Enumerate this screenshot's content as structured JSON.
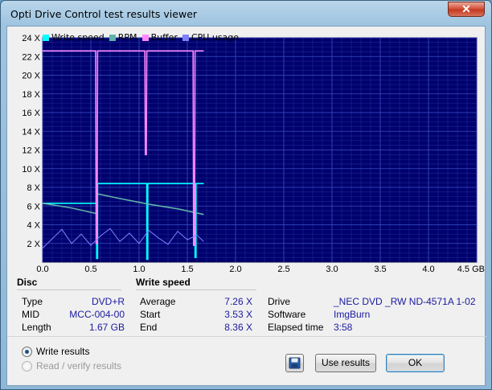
{
  "window": {
    "title": "Opti Drive Control test results viewer",
    "close_glyph": "✕"
  },
  "legend": [
    {
      "label": "Write speed",
      "color": "#00ffff"
    },
    {
      "label": "RPM",
      "color": "#5fb3a9"
    },
    {
      "label": "Buffer",
      "color": "#ff88ff"
    },
    {
      "label": "CPU usage",
      "color": "#8080ff"
    }
  ],
  "chart_data": {
    "type": "line",
    "xlim": [
      0,
      4.5
    ],
    "ylim": [
      0,
      24
    ],
    "x_ticks": [
      "0.0",
      "0.5",
      "1.0",
      "1.5",
      "2.0",
      "2.5",
      "3.0",
      "3.5",
      "4.0",
      "4.5 GB"
    ],
    "y_ticks": [
      "2 X",
      "4 X",
      "6 X",
      "8 X",
      "10 X",
      "12 X",
      "14 X",
      "16 X",
      "18 X",
      "20 X",
      "22 X",
      "24 X"
    ],
    "grid": true,
    "background": "#00006e",
    "series": [
      {
        "name": "Write speed",
        "color": "#00ffff",
        "x": [
          0.0,
          0.56,
          0.56,
          0.57,
          0.57,
          1.08,
          1.08,
          1.09,
          1.09,
          1.58,
          1.58,
          1.59,
          1.59,
          1.67
        ],
        "y": [
          6.3,
          6.3,
          0.4,
          0.4,
          8.4,
          8.4,
          0.3,
          0.3,
          8.4,
          8.4,
          0.5,
          0.5,
          8.4,
          8.4
        ]
      },
      {
        "name": "RPM",
        "color": "#5fb3a9",
        "x": [
          0.0,
          0.3,
          0.56,
          0.57,
          0.8,
          1.1,
          1.4,
          1.67
        ],
        "y": [
          6.3,
          5.8,
          5.2,
          7.3,
          6.8,
          6.2,
          5.7,
          5.1
        ]
      },
      {
        "name": "Buffer",
        "color": "#ff88ff",
        "x": [
          0.0,
          0.55,
          0.555,
          0.565,
          0.57,
          1.06,
          1.065,
          1.075,
          1.08,
          1.56,
          1.565,
          1.575,
          1.58,
          1.67
        ],
        "y": [
          22.6,
          22.6,
          2.0,
          2.0,
          22.6,
          22.6,
          11.5,
          11.5,
          22.6,
          22.6,
          1.8,
          1.8,
          22.6,
          22.6
        ]
      },
      {
        "name": "CPU usage",
        "color": "#8080ff",
        "x": [
          0.0,
          0.1,
          0.2,
          0.3,
          0.4,
          0.5,
          0.6,
          0.7,
          0.8,
          0.9,
          1.0,
          1.1,
          1.2,
          1.3,
          1.4,
          1.5,
          1.6,
          1.67
        ],
        "y": [
          1.5,
          2.5,
          3.5,
          2.0,
          3.0,
          1.8,
          2.8,
          3.6,
          2.2,
          3.1,
          2.0,
          3.4,
          2.6,
          1.9,
          3.3,
          2.4,
          2.9,
          2.2
        ]
      }
    ]
  },
  "disc": {
    "header": "Disc",
    "rows": [
      {
        "label": "Type",
        "value": "DVD+R"
      },
      {
        "label": "MID",
        "value": "MCC-004-00"
      },
      {
        "label": "Length",
        "value": "1.67 GB"
      }
    ]
  },
  "write_speed": {
    "header": "Write speed",
    "rows": [
      {
        "label": "Average",
        "value": "7.26 X"
      },
      {
        "label": "Start",
        "value": "3.53 X"
      },
      {
        "label": "End",
        "value": "8.36 X"
      }
    ]
  },
  "drive_info": {
    "rows": [
      {
        "label": "Drive",
        "value": "_NEC DVD _RW ND-4571A 1-02"
      },
      {
        "label": "Software",
        "value": "ImgBurn"
      },
      {
        "label": "Elapsed time",
        "value": "3:58"
      }
    ]
  },
  "options": {
    "write_results": "Write results",
    "read_verify_results": "Read / verify results"
  },
  "buttons": {
    "use_results": "Use results",
    "ok": "OK"
  }
}
